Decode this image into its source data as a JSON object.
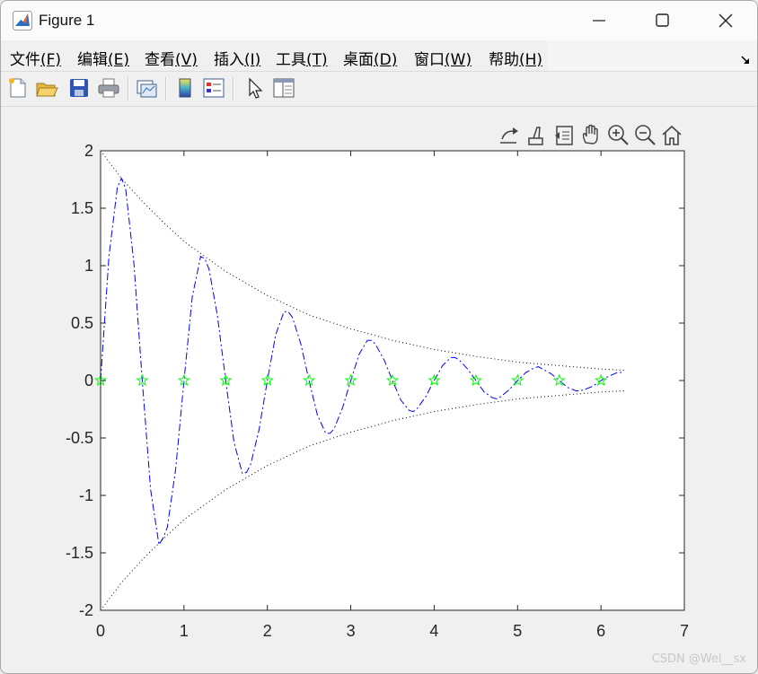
{
  "window": {
    "title": "Figure 1",
    "controls": [
      "minimize",
      "maximize",
      "close"
    ]
  },
  "menu": [
    {
      "label": "文件",
      "mnemonic": "(F)"
    },
    {
      "label": "编辑",
      "mnemonic": "(E)"
    },
    {
      "label": "查看",
      "mnemonic": "(V)"
    },
    {
      "label": "插入",
      "mnemonic": "(I)"
    },
    {
      "label": "工具",
      "mnemonic": "(T)"
    },
    {
      "label": "桌面",
      "mnemonic": "(D)"
    },
    {
      "label": "窗口",
      "mnemonic": "(W)"
    },
    {
      "label": "帮助",
      "mnemonic": "(H)"
    }
  ],
  "toolbar_icons": [
    "new-figure-icon",
    "open-file-icon",
    "save-icon",
    "print-icon",
    "link-plot-icon",
    "colorbar-icon",
    "legend-icon",
    "pointer-icon",
    "property-editor-icon"
  ],
  "axes_toolbar_icons": [
    "export-icon",
    "brush-icon",
    "data-tips-icon",
    "pan-icon",
    "zoom-in-icon",
    "zoom-out-icon",
    "home-icon"
  ],
  "watermark": "CSDN @Wei__sx",
  "chart_data": {
    "type": "line",
    "xlim": [
      0,
      7
    ],
    "ylim": [
      -2,
      2
    ],
    "xticks": [
      0,
      1,
      2,
      3,
      4,
      5,
      6,
      7
    ],
    "yticks": [
      2,
      1.5,
      1,
      0.5,
      0,
      -0.5,
      -1,
      -1.5,
      -2
    ],
    "grid": false,
    "series": [
      {
        "role": "oscillation",
        "style": "dash-dot",
        "color": "#0000ff",
        "x": [
          0,
          0.1,
          0.2,
          0.25,
          0.3,
          0.4,
          0.5,
          0.6,
          0.7,
          0.75,
          0.8,
          0.9,
          1.0,
          1.1,
          1.2,
          1.25,
          1.3,
          1.4,
          1.5,
          1.6,
          1.7,
          1.75,
          1.8,
          1.9,
          2.0,
          2.1,
          2.2,
          2.25,
          2.3,
          2.4,
          2.5,
          2.6,
          2.7,
          2.75,
          2.8,
          2.9,
          3.0,
          3.1,
          3.2,
          3.25,
          3.3,
          3.4,
          3.5,
          3.6,
          3.7,
          3.75,
          3.8,
          3.9,
          4.0,
          4.1,
          4.2,
          4.25,
          4.3,
          4.4,
          4.5,
          4.6,
          4.7,
          4.75,
          4.8,
          4.9,
          5.0,
          5.1,
          5.2,
          5.25,
          5.3,
          5.4,
          5.5,
          5.6,
          5.7,
          5.75,
          5.8,
          5.9,
          6.0,
          6.1,
          6.2,
          6.28
        ],
        "y": [
          0,
          1.08,
          1.68,
          1.76,
          1.67,
          1.02,
          0,
          -0.95,
          -1.43,
          -1.37,
          -1.28,
          -0.77,
          0,
          0.73,
          1.08,
          1.06,
          0.97,
          0.57,
          0,
          -0.54,
          -0.81,
          -0.8,
          -0.73,
          -0.43,
          0,
          0.4,
          0.6,
          0.6,
          0.55,
          0.32,
          0,
          -0.3,
          -0.46,
          -0.46,
          -0.42,
          -0.24,
          0,
          0.23,
          0.35,
          0.35,
          0.31,
          0.18,
          0,
          -0.17,
          -0.26,
          -0.27,
          -0.24,
          -0.14,
          0,
          0.13,
          0.2,
          0.2,
          0.18,
          0.1,
          0,
          -0.1,
          -0.15,
          -0.16,
          -0.14,
          -0.08,
          0,
          0.07,
          0.11,
          0.12,
          0.1,
          0.06,
          0,
          -0.06,
          -0.09,
          -0.09,
          -0.08,
          -0.05,
          0,
          0.04,
          0.07,
          0.07
        ]
      },
      {
        "role": "upper-envelope",
        "style": "dotted",
        "color": "#000000",
        "x": [
          0,
          0.25,
          0.5,
          0.75,
          1,
          1.5,
          2,
          2.5,
          3,
          3.5,
          4,
          4.5,
          5,
          5.5,
          6,
          6.28
        ],
        "y": [
          2,
          1.76,
          1.56,
          1.38,
          1.21,
          0.95,
          0.74,
          0.57,
          0.45,
          0.35,
          0.27,
          0.21,
          0.16,
          0.13,
          0.1,
          0.09
        ]
      },
      {
        "role": "lower-envelope",
        "style": "dotted",
        "color": "#000000",
        "x": [
          0,
          0.25,
          0.5,
          0.75,
          1,
          1.5,
          2,
          2.5,
          3,
          3.5,
          4,
          4.5,
          5,
          5.5,
          6,
          6.28
        ],
        "y": [
          -2,
          -1.76,
          -1.56,
          -1.38,
          -1.21,
          -0.95,
          -0.74,
          -0.57,
          -0.45,
          -0.35,
          -0.27,
          -0.21,
          -0.16,
          -0.13,
          -0.1,
          -0.09
        ]
      },
      {
        "role": "zero-markers",
        "style": "markers",
        "marker": "star",
        "color": "#00ff00",
        "x": [
          0,
          0.5,
          1,
          1.5,
          2,
          2.5,
          3,
          3.5,
          4,
          4.5,
          5,
          5.5,
          6
        ],
        "y": [
          0,
          0,
          0,
          0,
          0,
          0,
          0,
          0,
          0,
          0,
          0,
          0,
          0
        ]
      }
    ]
  }
}
